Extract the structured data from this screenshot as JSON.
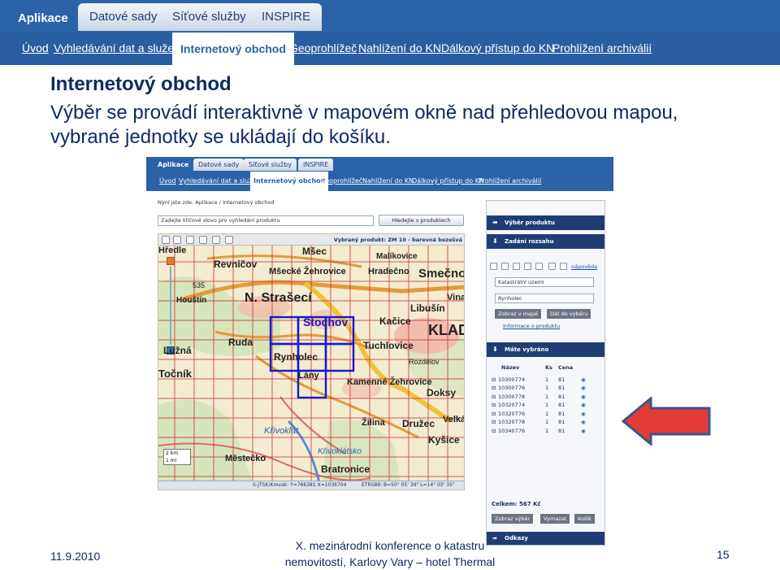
{
  "banner": {
    "tabs": [
      "Aplikace",
      "Datové sady",
      "Síťové služby",
      "INSPIRE"
    ],
    "subnav": [
      "Úvod",
      "Vyhledávání dat a služeb",
      "Internetový obchod",
      "Geoprohlížeč",
      "Nahlížení do KN",
      "Dálkový přístup do KN",
      "Prohlížení archiválií"
    ],
    "active": "Internetový obchod"
  },
  "slide": {
    "title": "Internetový obchod",
    "description": "Výběr se provádí interaktivně v mapovém okně nad přehledovou mapou, vybrané jednotky se ukládají do košíku."
  },
  "shot": {
    "tabs": [
      "Aplikace",
      "Datové sady",
      "Síťové služby",
      "INSPIRE"
    ],
    "subnav": [
      "Úvod",
      "Vyhledávání dat a služeb",
      "Internetový obchod",
      "Geoprohlížeč",
      "Nahlížení do KN",
      "Dálkový přístup do KN",
      "Prohlížení archiválií"
    ],
    "breadcrumb": "Nyní jste zde: Aplikace / Internetový obchod",
    "search_placeholder": "Zadejte klíčové slovo pro vyhledání produktu",
    "search_button": "Hledejte v produktech",
    "map": {
      "selected_product": "Vybraný produkt: ZM 10 - barevná bezešvá",
      "status_left": "S-JTSK/Krovak: Y=766381 X=1036704",
      "status_right": "ETRS89: B=50° 05' 39\" L=14° 03' 35\"",
      "scale": [
        "2 km",
        "1 mi"
      ],
      "places": [
        "Mšec",
        "Malíkovice",
        "Revničov",
        "Mšecké Žehrovice",
        "Hradečno",
        "Smečno",
        "535",
        "Houštín",
        "N. Strašecí",
        "Vinařice",
        "Libušín",
        "Stochov",
        "Kačice",
        "KLADNO",
        "Lužná",
        "Ruda",
        "Rynholec",
        "Tuchlovice",
        "Rozdělov",
        "Lány",
        "Kamenné Žehrovice",
        "Doksy",
        "Hředle",
        "Křivoklát",
        "Družec",
        "Velká",
        "Žilina",
        "Kyšice",
        "Městečko",
        "Bratronice",
        "Křivoklátsko",
        "Točník"
      ]
    },
    "panel": {
      "header_product": "Výběr produktu",
      "header_range": "Zadání rozsahu",
      "help_link": "nápověda",
      "select_value": "Katastrální území",
      "input_value": "Rynholec",
      "btn_show": "Zobraz v mapě",
      "btn_add": "Dát do výběru",
      "info_link": "Informace o produktu",
      "header_selected": "Máte vybráno",
      "columns": [
        "Název",
        "Ks",
        "Cena"
      ],
      "rows": [
        [
          "10300774",
          "1",
          "81"
        ],
        [
          "10300776",
          "1",
          "81"
        ],
        [
          "10300778",
          "1",
          "81"
        ],
        [
          "10320774",
          "1",
          "81"
        ],
        [
          "10320776",
          "1",
          "81"
        ],
        [
          "10320778",
          "1",
          "81"
        ],
        [
          "10340776",
          "1",
          "81"
        ]
      ],
      "total": "Celkem: 567 Kč",
      "btn_view": "Zobraz výběr",
      "btn_clear": "Vymazat",
      "btn_cart": "Košík",
      "header_orders": "Odkazy"
    }
  },
  "footer": {
    "date": "11.9.2010",
    "conference_line1": "X. mezinárodní konference o katastru",
    "conference_line2": "nemovitostí, Karlovy Vary – hotel Thermal",
    "page": "15"
  },
  "colors": {
    "banner": "#2b62a8",
    "navy": "#1f3d73",
    "title": "#0f2a64",
    "arrow": "#e53b36"
  }
}
